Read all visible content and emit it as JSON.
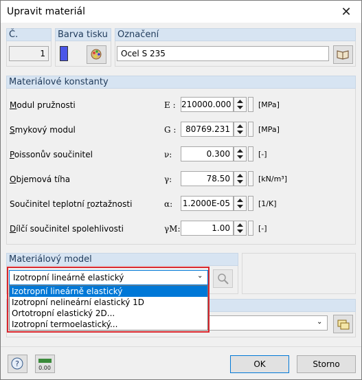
{
  "window": {
    "title": "Upravit materiál",
    "close_icon": "close-icon"
  },
  "header_row": {
    "number_label": "Č.",
    "number_value": "1",
    "color_label": "Barva tisku",
    "color_value": "#4a56e8",
    "name_label": "Označení",
    "name_value": "Ocel S 235"
  },
  "constants": {
    "title": "Materiálové konstanty",
    "rows": [
      {
        "label": "Modul pružnosti",
        "accel": "M",
        "rest": "odul pružnosti",
        "symbol": "E :",
        "value": "210000.000",
        "unit": "[MPa]"
      },
      {
        "label": "Smykový modul",
        "accel": "S",
        "rest": "mykový modul",
        "symbol": "G :",
        "value": "80769.231",
        "unit": "[MPa]"
      },
      {
        "label": "Poissonův součinitel",
        "accel": "P",
        "rest": "oissonův součinitel",
        "symbol": "ν:",
        "value": "0.300",
        "unit": "[-]"
      },
      {
        "label": "Objemová tíha",
        "accel": "O",
        "rest": "bjemová tíha",
        "symbol": "γ:",
        "value": "78.50",
        "unit": "[kN/m³]"
      },
      {
        "label": "Součinitel teplotní roztažnosti",
        "pre": "Součinitel teplotní ",
        "accel": "r",
        "rest": "oztažnosti",
        "symbol": "α:",
        "value": "1.2000E-05",
        "unit": "[1/K]"
      },
      {
        "label": "Dílčí součinitel spolehlivosti",
        "accel": "D",
        "rest": "ílčí součinitel spolehlivosti",
        "symbol": "γM:",
        "value": "1.00",
        "unit": "[-]"
      }
    ]
  },
  "model": {
    "title": "Materiálový model",
    "selected": "Izotropní lineárně elastický",
    "options": [
      "Izotropní lineárně elastický",
      "Izotropní nelineární elastický 1D",
      "Ortotropní elastický 2D...",
      "Izotropní termoelastický..."
    ]
  },
  "footer": {
    "ok_label": "OK",
    "cancel_label": "Storno"
  }
}
